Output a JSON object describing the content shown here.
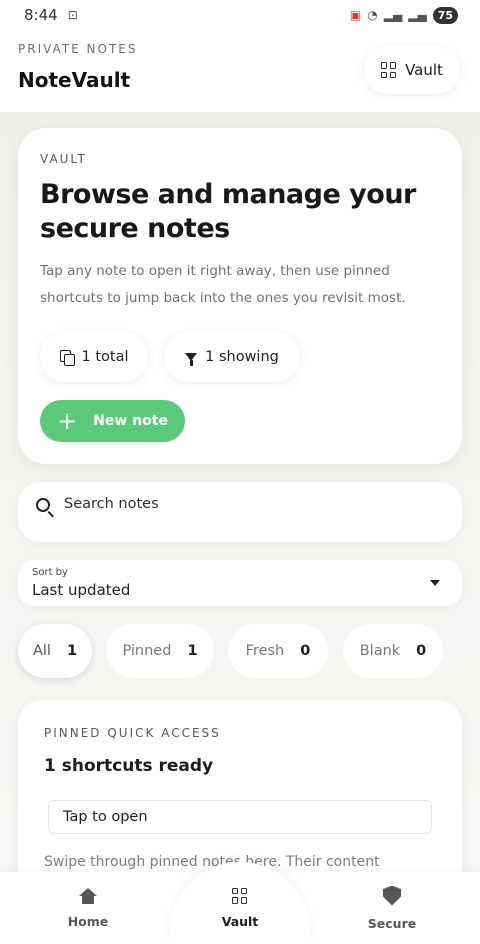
{
  "status_bar": {
    "time": "8:44",
    "battery": "75"
  },
  "header": {
    "eyebrow": "PRIVATE NOTES",
    "title": "NoteVault",
    "vault_button_label": "Vault"
  },
  "hero": {
    "eyebrow": "VAULT",
    "title": "Browse and manage your secure notes",
    "description": "Tap any note to open it right away, then use pinned shortcuts to jump back into the ones you revisit most.",
    "stat_total": "1 total",
    "stat_showing": "1 showing",
    "new_note_label": "New note"
  },
  "search": {
    "placeholder": "Search notes"
  },
  "sort": {
    "caption": "Sort by",
    "value": "Last updated"
  },
  "filters": [
    {
      "label": "All",
      "count": "1",
      "active": true
    },
    {
      "label": "Pinned",
      "count": "1",
      "active": false
    },
    {
      "label": "Fresh",
      "count": "0",
      "active": false
    },
    {
      "label": "Blank",
      "count": "0",
      "active": false
    }
  ],
  "pinned": {
    "eyebrow": "PINNED QUICK ACCESS",
    "title": "1 shortcuts ready",
    "tap_label": "Tap to open",
    "description": "Swipe through pinned notes here. Their content"
  },
  "bottom_nav": {
    "items": [
      {
        "label": "Home",
        "icon": "home-icon"
      },
      {
        "label": "Vault",
        "icon": "grid-icon",
        "active": true
      },
      {
        "label": "Secure",
        "icon": "shield-icon"
      }
    ]
  },
  "colors": {
    "accent_green": "#5cc97a",
    "background": "#f4f5f2"
  }
}
